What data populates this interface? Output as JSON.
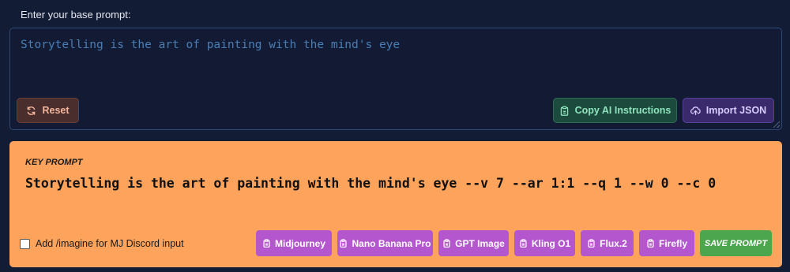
{
  "base": {
    "label": "Enter your base prompt:",
    "value": "Storytelling is the art of painting with the mind's eye"
  },
  "toolbar": {
    "reset_label": "Reset",
    "copy_label": "Copy AI Instructions",
    "import_label": "Import JSON"
  },
  "key": {
    "label": "KEY PROMPT",
    "text": "Storytelling is the art of painting with the mind's eye --v 7 --ar 1:1 --q 1 --w 0 --c 0"
  },
  "discord": {
    "label": "Add /imagine for MJ Discord input",
    "checked": false
  },
  "models": [
    {
      "label": "Midjourney"
    },
    {
      "label": "Nano Banana Pro"
    },
    {
      "label": "GPT Image"
    },
    {
      "label": "Kling O1"
    },
    {
      "label": "Flux.2"
    },
    {
      "label": "Firefly"
    }
  ],
  "save_label": "SAVE PROMPT",
  "colors": {
    "background": "#131c35",
    "key_panel": "#fda35b",
    "model_button": "#b457cf",
    "save_button": "#4ca64d"
  }
}
